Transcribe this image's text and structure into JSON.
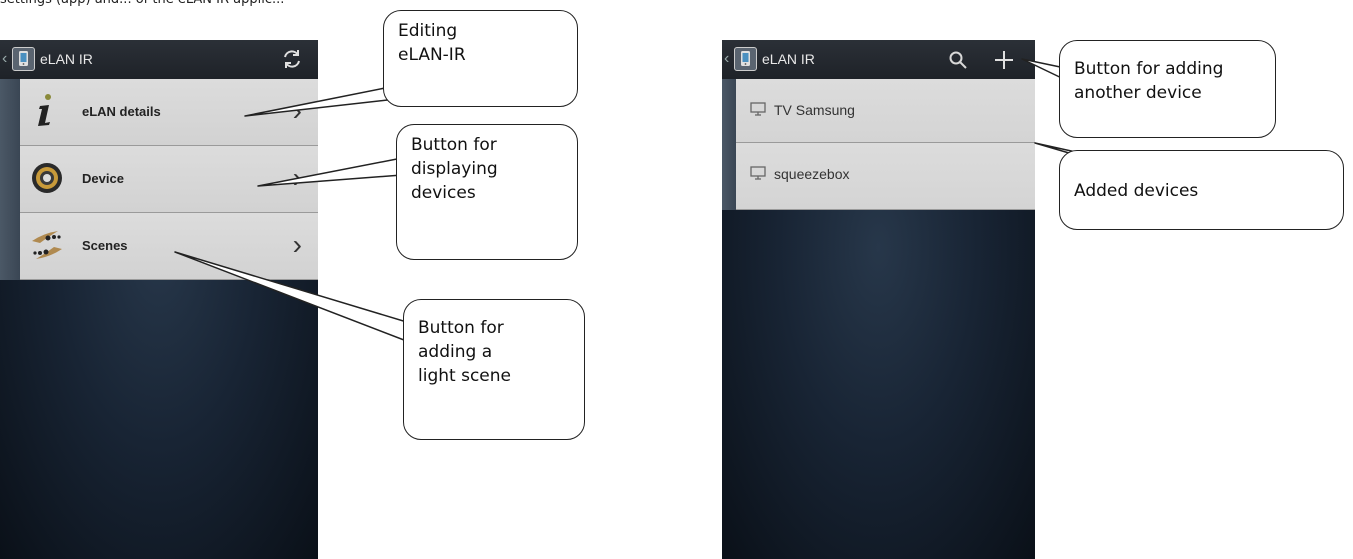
{
  "caption": "settings (app) and... of the eLAN IR applic...",
  "left_screen": {
    "title": "eLAN IR",
    "menu": [
      {
        "label": "eLAN details",
        "icon": "info-icon"
      },
      {
        "label": "Device",
        "icon": "gear-icon"
      },
      {
        "label": "Scenes",
        "icon": "scenes-icon"
      }
    ]
  },
  "right_screen": {
    "title": "eLAN IR",
    "devices": [
      {
        "label": "TV Samsung",
        "icon": "monitor-icon"
      },
      {
        "label": "squeezebox",
        "icon": "monitor-icon"
      }
    ]
  },
  "callouts": {
    "editing": "Editing\neLAN-IR",
    "display_devices": "Button for\ndisplaying\ndevices",
    "light_scene": "Button for\nadding a\nlight scene",
    "add_device": "Button for adding\nanother device",
    "added_devices": "Added devices"
  }
}
